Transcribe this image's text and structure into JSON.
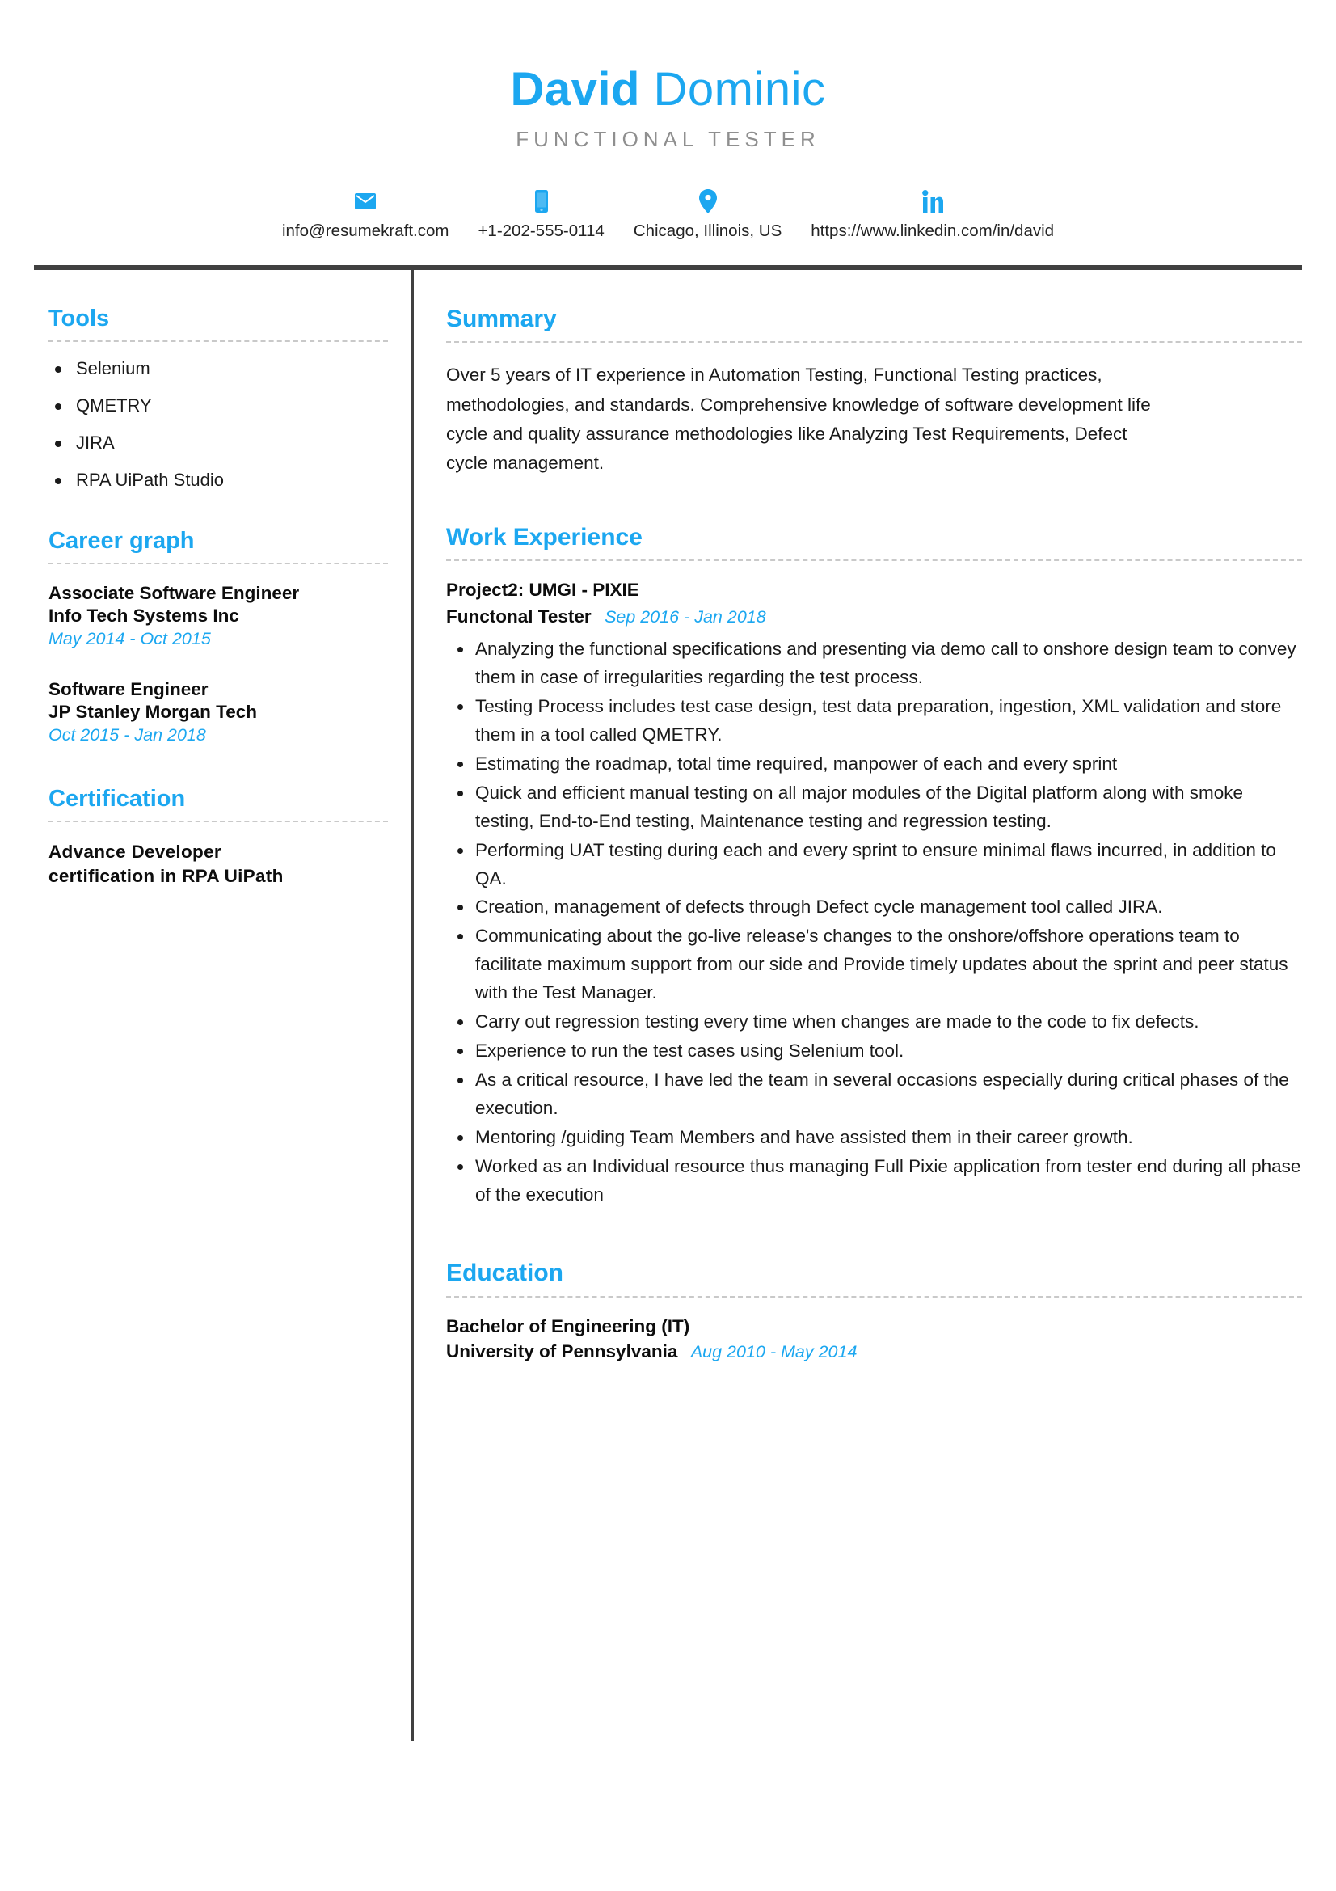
{
  "header": {
    "first_name": "David",
    "last_name": "Dominic",
    "job_subtitle": "FUNCTIONAL TESTER",
    "accent_color": "#1ca7f0",
    "rule_color": "#404040"
  },
  "contact": [
    {
      "icon": "envelope-icon",
      "name": "email",
      "text": "info@resumekraft.com"
    },
    {
      "icon": "phone-icon",
      "name": "phone",
      "text": "+1-202-555-0114"
    },
    {
      "icon": "location-pin-icon",
      "name": "location",
      "text": "Chicago, Illinois, US"
    },
    {
      "icon": "linkedin-icon",
      "name": "linkedin",
      "text": "https://www.linkedin.com/in/david"
    }
  ],
  "sidebar": {
    "tools": {
      "title": "Tools",
      "items": [
        "Selenium",
        "QMETRY",
        "JIRA",
        "RPA UiPath Studio"
      ]
    },
    "career_graph": {
      "title": "Career graph",
      "entries": [
        {
          "role": "Associate Software Engineer",
          "organization": "Info Tech Systems Inc",
          "dates": "May 2014 - Oct 2015"
        },
        {
          "role": "Software Engineer",
          "organization": "JP Stanley Morgan Tech",
          "dates": "Oct 2015 - Jan 2018"
        }
      ]
    },
    "certification": {
      "title": "Certification",
      "line1": "Advance Developer",
      "line2": "certification in RPA UiPath"
    }
  },
  "main": {
    "summary": {
      "title": "Summary",
      "text": "Over 5 years of IT experience in Automation Testing, Functional Testing practices, methodologies, and standards. Comprehensive knowledge of software development life cycle and quality assurance methodologies like Analyzing Test Requirements, Defect cycle management."
    },
    "work_experience": {
      "title": "Work Experience",
      "jobs": [
        {
          "project": "Project2: UMGI - PIXIE",
          "title": "Functonal Tester",
          "dates": "Sep 2016 - Jan 2018",
          "bullets": [
            "Analyzing the functional specifications and presenting via demo call to onshore design team to convey them in case of irregularities regarding the test process.",
            "Testing Process includes test case design, test data preparation, ingestion, XML validation and store them in a tool called QMETRY.",
            "Estimating the roadmap, total time required,  manpower of each and every sprint",
            "Quick and efficient manual testing on all major modules of the Digital platform along with smoke testing, End-to-End testing, Maintenance testing and regression testing.",
            "Performing UAT testing during each and every sprint to ensure minimal flaws incurred, in addition to QA.",
            "Creation, management of defects through Defect cycle management tool called JIRA.",
            "Communicating about the go-live release's changes to the onshore/offshore operations team to facilitate maximum support from our side and Provide timely updates about the sprint and peer status with the Test Manager.",
            "Carry out regression testing every time when changes are made to the code to fix defects.",
            "Experience to run the test cases using Selenium tool.",
            "As a critical resource, I have led the team in several occasions especially during critical phases of the execution.",
            "Mentoring /guiding Team Members and have assisted them in their career growth.",
            "Worked as an Individual resource  thus managing Full Pixie application from tester end during all phase of the execution"
          ]
        }
      ]
    },
    "education": {
      "title": "Education",
      "degree": "Bachelor of Engineering (IT)",
      "school": "University of Pennsylvania",
      "dates": "Aug 2010 - May 2014"
    }
  }
}
